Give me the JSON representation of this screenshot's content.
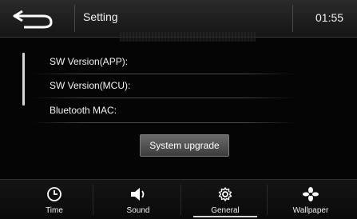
{
  "header": {
    "title": "Setting",
    "clock": "01:55",
    "back_icon": "back-arrow-icon"
  },
  "info": {
    "rows": [
      {
        "label": "SW Version(APP):",
        "value": ""
      },
      {
        "label": "SW Version(MCU):",
        "value": ""
      },
      {
        "label": "Bluetooth MAC:",
        "value": ""
      }
    ]
  },
  "actions": {
    "upgrade_label": "System upgrade"
  },
  "tabs": [
    {
      "label": "Time",
      "icon": "clock-icon",
      "active": false
    },
    {
      "label": "Sound",
      "icon": "speaker-icon",
      "active": false
    },
    {
      "label": "General",
      "icon": "gear-icon",
      "active": true
    },
    {
      "label": "Wallpaper",
      "icon": "wallpaper-icon",
      "active": false
    }
  ],
  "colors": {
    "background": "#050505",
    "text": "#f0f0f0",
    "button": "#5a5a5a"
  }
}
